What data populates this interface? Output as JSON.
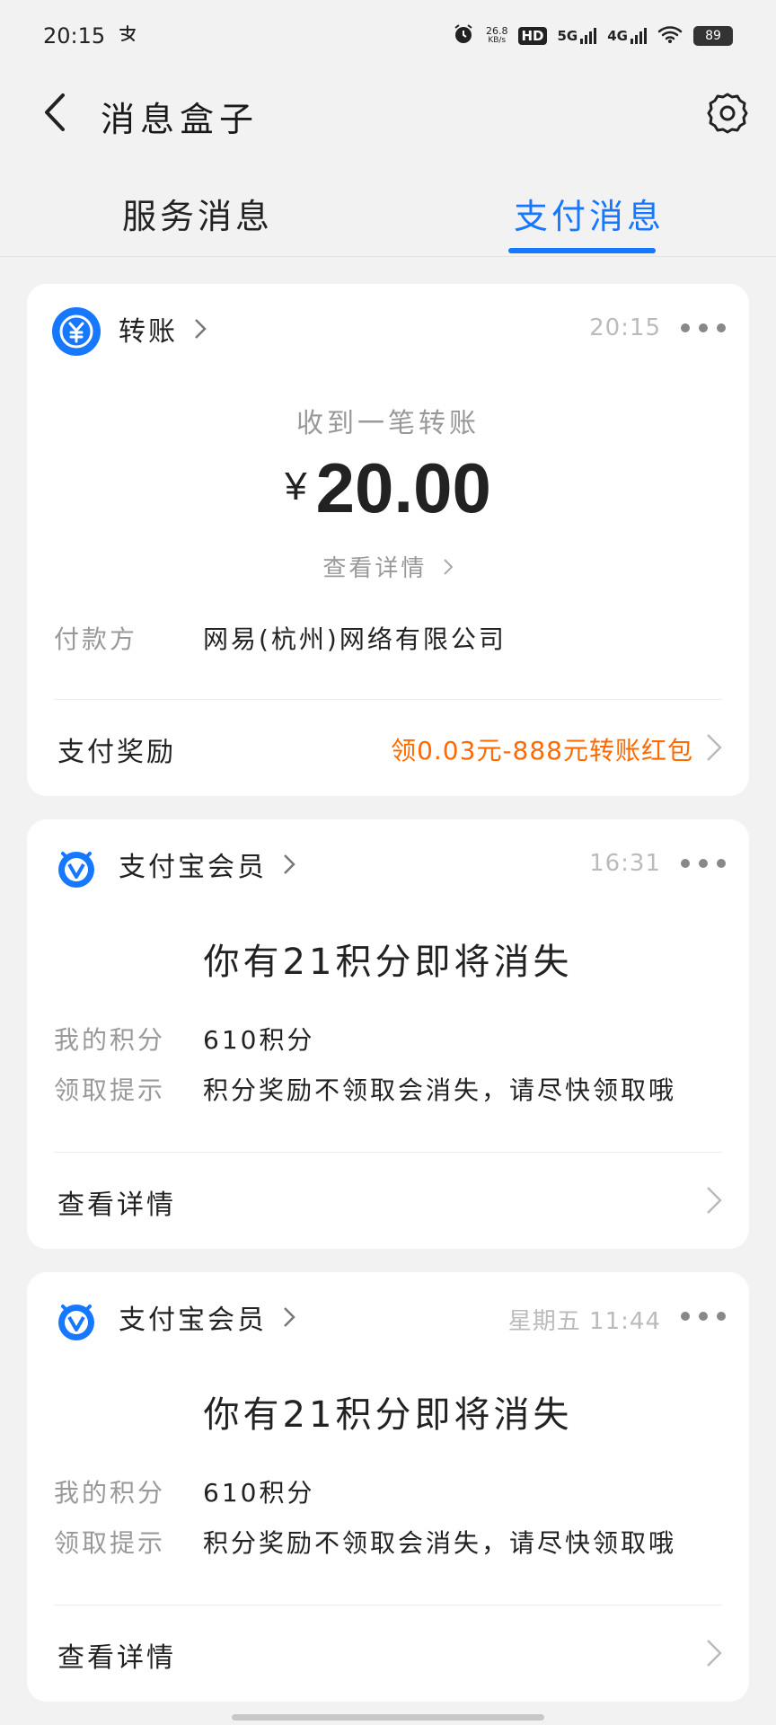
{
  "status_bar": {
    "time": "20:15",
    "carrier_icon": "alipay-mark",
    "net_speed_value": "26.8",
    "net_speed_unit": "KB/s",
    "hd": "HD",
    "net1": "5G",
    "net2": "4G",
    "battery": "89"
  },
  "header": {
    "title": "消息盒子"
  },
  "tabs": [
    {
      "label": "服务消息",
      "active": false
    },
    {
      "label": "支付消息",
      "active": true
    }
  ],
  "cards": [
    {
      "source": "转账",
      "time": "20:15",
      "caption": "收到一笔转账",
      "currency": "¥",
      "amount": "20.00",
      "detail_link": "查看详情",
      "payer_label": "付款方",
      "payer_value": "网易(杭州)网络有限公司",
      "footer_label": "支付奖励",
      "footer_reward": "领0.03元-888元转账红包"
    },
    {
      "source": "支付宝会员",
      "time": "16:31",
      "title": "你有21积分即将消失",
      "points_label": "我的积分",
      "points_value": "610积分",
      "tip_label": "领取提示",
      "tip_value": "积分奖励不领取会消失，请尽快领取哦",
      "footer_label": "查看详情"
    },
    {
      "source": "支付宝会员",
      "time": "星期五 11:44",
      "title": "你有21积分即将消失",
      "points_label": "我的积分",
      "points_value": "610积分",
      "tip_label": "领取提示",
      "tip_value": "积分奖励不领取会消失，请尽快领取哦",
      "footer_label": "查看详情"
    }
  ],
  "colors": {
    "accent": "#1677ff",
    "reward": "#ff6a00",
    "background": "#f2f2f2"
  }
}
